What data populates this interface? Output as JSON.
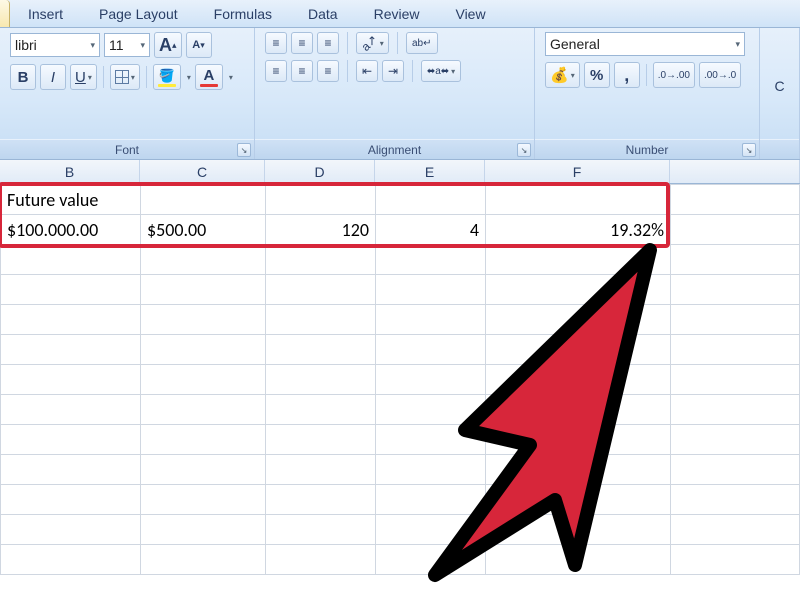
{
  "tabs": {
    "insert": "Insert",
    "page_layout": "Page Layout",
    "formulas": "Formulas",
    "data": "Data",
    "review": "Review",
    "view": "View"
  },
  "font": {
    "name": "libri",
    "size": "11",
    "grow_tip": "A",
    "shrink_tip": "A",
    "bold": "B",
    "italic": "I",
    "underline": "U",
    "group_label": "Font"
  },
  "alignment": {
    "group_label": "Alignment",
    "wrap_tip": "Wrap",
    "merge_tip": "Merge"
  },
  "number": {
    "format": "General",
    "group_label": "Number",
    "currency_tip": "$",
    "percent_tip": "%",
    "comma_tip": ",",
    "inc_dec_tip": ".0",
    "dec_dec_tip": ".00"
  },
  "ribbon_right": {
    "c_label": "C"
  },
  "columns": {
    "B": "B",
    "C": "C",
    "D": "D",
    "E": "E",
    "F": "F"
  },
  "cells": {
    "r1": {
      "b": "Future value",
      "c": "",
      "d": "",
      "e": "",
      "f": ""
    },
    "r2": {
      "b": "$100.000.00",
      "c": "$500.00",
      "d": "120",
      "e": "4",
      "f": "19.32%"
    }
  },
  "col_widths": {
    "B": 140,
    "C": 125,
    "D": 110,
    "E": 110,
    "F": 185
  },
  "icons": {
    "dropdown": "▾",
    "launcher": "↘"
  }
}
